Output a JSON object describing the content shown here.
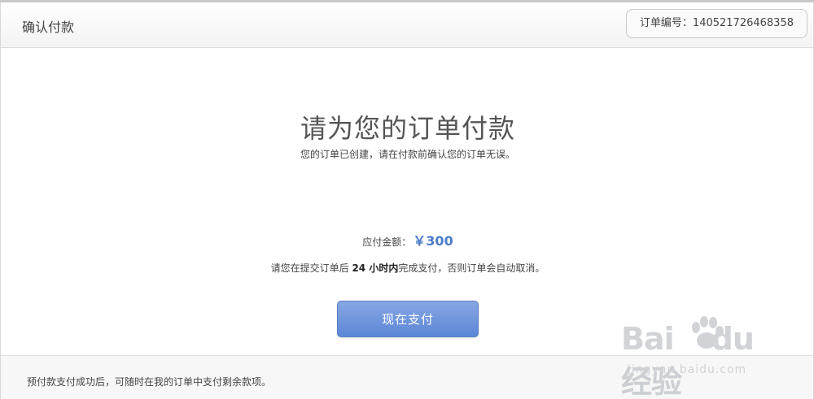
{
  "header": {
    "title": "确认付款",
    "order_label": "订单编号：",
    "order_number": "140521726468358"
  },
  "main": {
    "title": "请为您的订单付款",
    "subtitle": "您的订单已创建，请在付款前确认您的订单无误。",
    "amount_label": "应付金额：",
    "amount_value": "￥300",
    "deadline_prefix": "请您在提交订单后 ",
    "deadline_bold": "24 小时内",
    "deadline_suffix": "完成支付，否则订单会自动取消。",
    "pay_button": "现在支付"
  },
  "footer": {
    "note": "预付款支付成功后，可随时在我的订单中支付剩余款项。"
  },
  "watermark": {
    "brand": "Bai du经验",
    "url": "jingyan.baidu.com"
  },
  "colors": {
    "accent": "#4a7cc9",
    "button": "#5b86d6"
  }
}
